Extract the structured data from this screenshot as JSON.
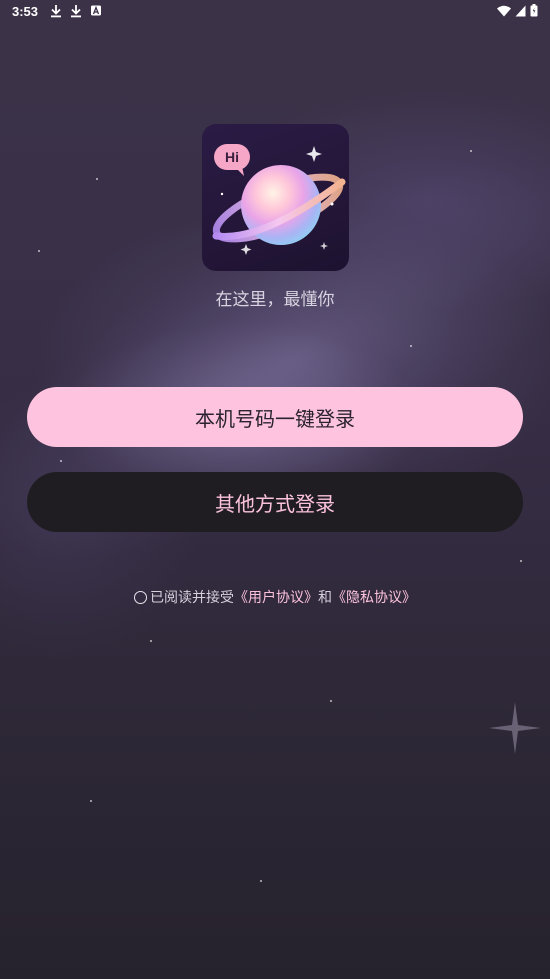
{
  "status_bar": {
    "time": "3:53",
    "left_icons": [
      "download-icon",
      "download-icon",
      "font-a-icon"
    ],
    "right_icons": [
      "wifi-icon",
      "cellular-signal-icon",
      "battery-icon"
    ]
  },
  "app": {
    "logo_icon": "planet-logo-icon",
    "logo_bubble_text": "Hi",
    "slogan": "在这里，最懂你"
  },
  "login": {
    "one_click_label": "本机号码一键登录",
    "other_methods_label": "其他方式登录"
  },
  "agreement": {
    "prefix": "已阅读并接受",
    "user_agreement": "《用户协议》",
    "conjunction": "和",
    "privacy_policy": "《隐私协议》",
    "checked": false
  },
  "colors": {
    "primary_button_bg": "#fec4df",
    "secondary_button_bg": "#1f1d22",
    "accent_pink": "#fcc2dc",
    "background_top": "#3b3247",
    "background_bottom": "#26222d"
  }
}
